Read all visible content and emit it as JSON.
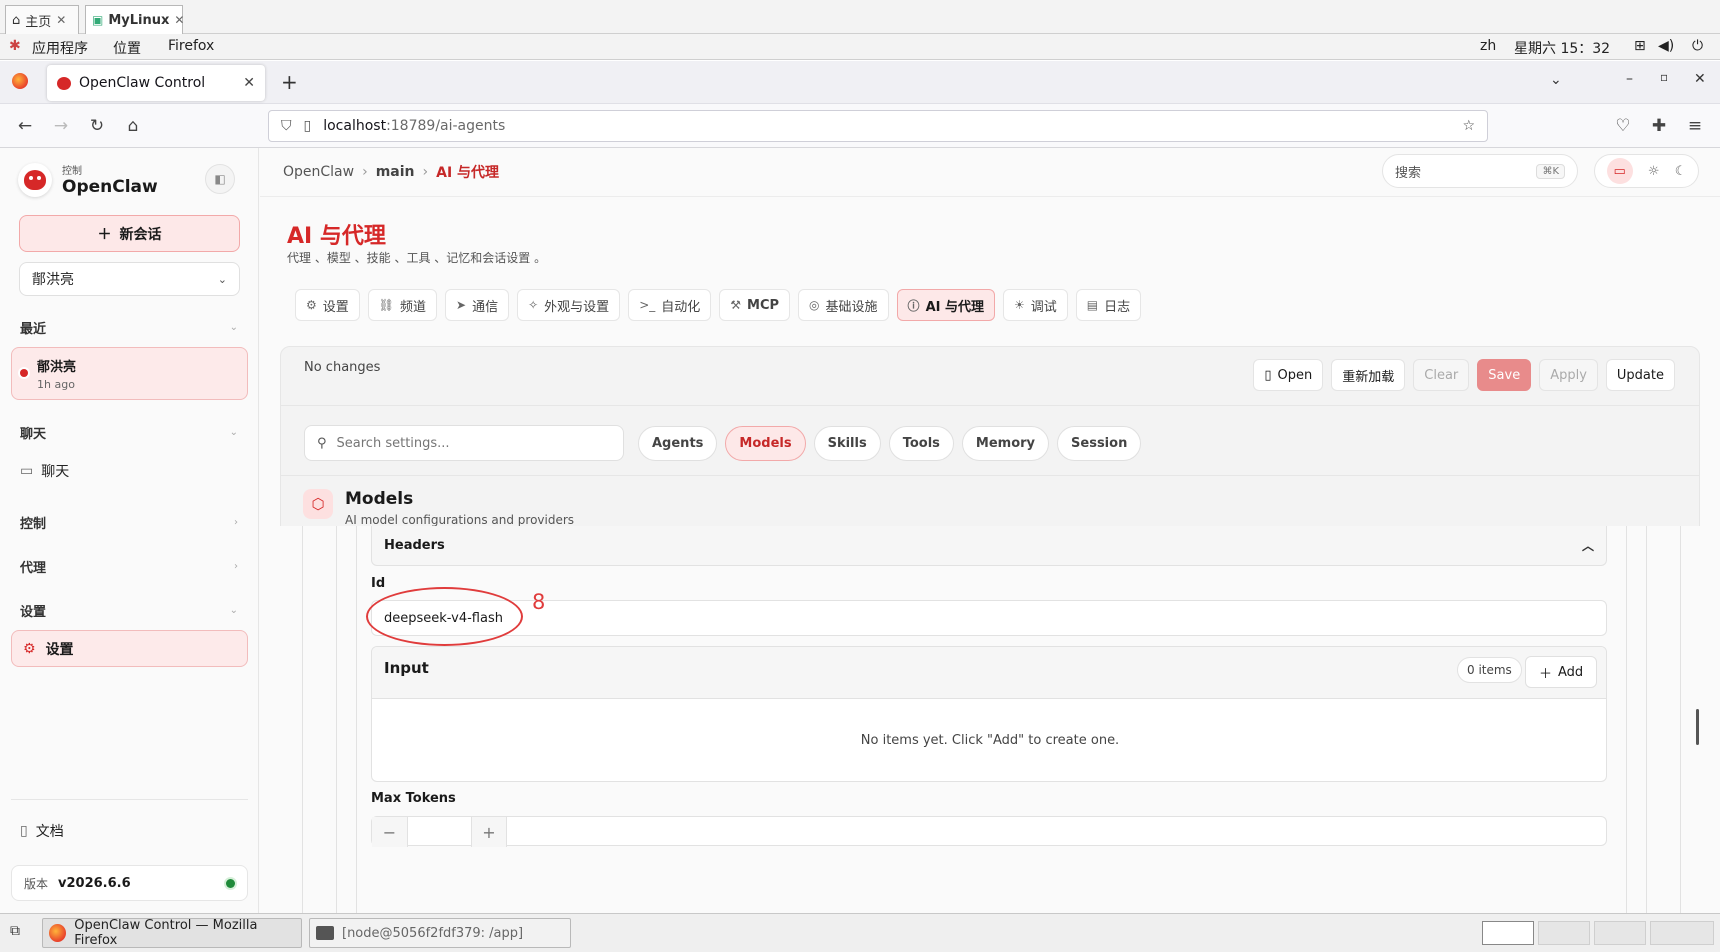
{
  "os": {
    "tabs": [
      {
        "icon": "home-icon",
        "label": "主页"
      },
      {
        "icon": "terminal-icon",
        "label": "MyLinux"
      }
    ],
    "menu": [
      "应用程序",
      "位置",
      "Firefox"
    ],
    "lang": "zh",
    "clock": "星期六 15：32"
  },
  "browser": {
    "tab_title": "OpenClaw Control",
    "url_host": "localhost",
    "url_path": ":18789/ai-agents"
  },
  "sidebar": {
    "brand_sub": "控制",
    "brand_name": "OpenClaw",
    "new_chat": "新会话",
    "agent_select": "鄁洪亮",
    "recent_label": "最近",
    "recent_item_title": "鄁洪亮",
    "recent_item_time": "1h ago",
    "chat_section": "聊天",
    "chat_item": "聊天",
    "control_section": "控制",
    "agent_section": "代理",
    "settings_section": "设置",
    "settings_item": "设置",
    "docs": "文档",
    "version_label": "版本",
    "version_value": "v2026.6.6"
  },
  "header": {
    "crumbs": [
      "OpenClaw",
      "main",
      "AI 与代理"
    ],
    "search_placeholder": "搜索",
    "search_shortcut": "⌘K"
  },
  "page": {
    "title": "AI 与代理",
    "subtitle": "代理 、模型 、技能 、工具 、记忆和会话设置 。"
  },
  "nav_tabs": [
    {
      "icon": "gear-icon",
      "label": "设置"
    },
    {
      "icon": "link-icon",
      "label": "频道"
    },
    {
      "icon": "send-icon",
      "label": "通信"
    },
    {
      "icon": "sparkle-icon",
      "label": "外观与设置"
    },
    {
      "icon": "terminal-prompt-icon",
      "label": "自动化"
    },
    {
      "icon": "wrench-icon",
      "label": "MCP"
    },
    {
      "icon": "globe-icon",
      "label": "基础设施"
    },
    {
      "icon": "brain-icon",
      "label": "AI 与代理"
    },
    {
      "icon": "bug-icon",
      "label": "调试"
    },
    {
      "icon": "log-icon",
      "label": "日志"
    }
  ],
  "panel": {
    "status": "No changes",
    "actions": {
      "open": "Open",
      "reload": "重新加载",
      "clear": "Clear",
      "save": "Save",
      "apply": "Apply",
      "update": "Update"
    },
    "search_placeholder": "Search settings...",
    "pills": [
      "Agents",
      "Models",
      "Skills",
      "Tools",
      "Memory",
      "Session"
    ],
    "section_title": "Models",
    "section_sub": "AI model configurations and providers"
  },
  "form": {
    "headers_label": "Headers",
    "id_label": "Id",
    "id_value": "deepseek-v4-flash",
    "annotation_number": "8",
    "input_label": "Input",
    "input_count": "0 items",
    "add_label": "Add",
    "empty_message": "No items yet. Click \"Add\" to create one.",
    "max_tokens_label": "Max Tokens"
  },
  "taskbar": {
    "window1": "OpenClaw Control — Mozilla Firefox",
    "window2": "[node@5056f2fdf379: /app]"
  },
  "colors": {
    "accent": "#d62828",
    "accent_soft": "#fde8e8",
    "status_ok": "#1f8a3a"
  }
}
